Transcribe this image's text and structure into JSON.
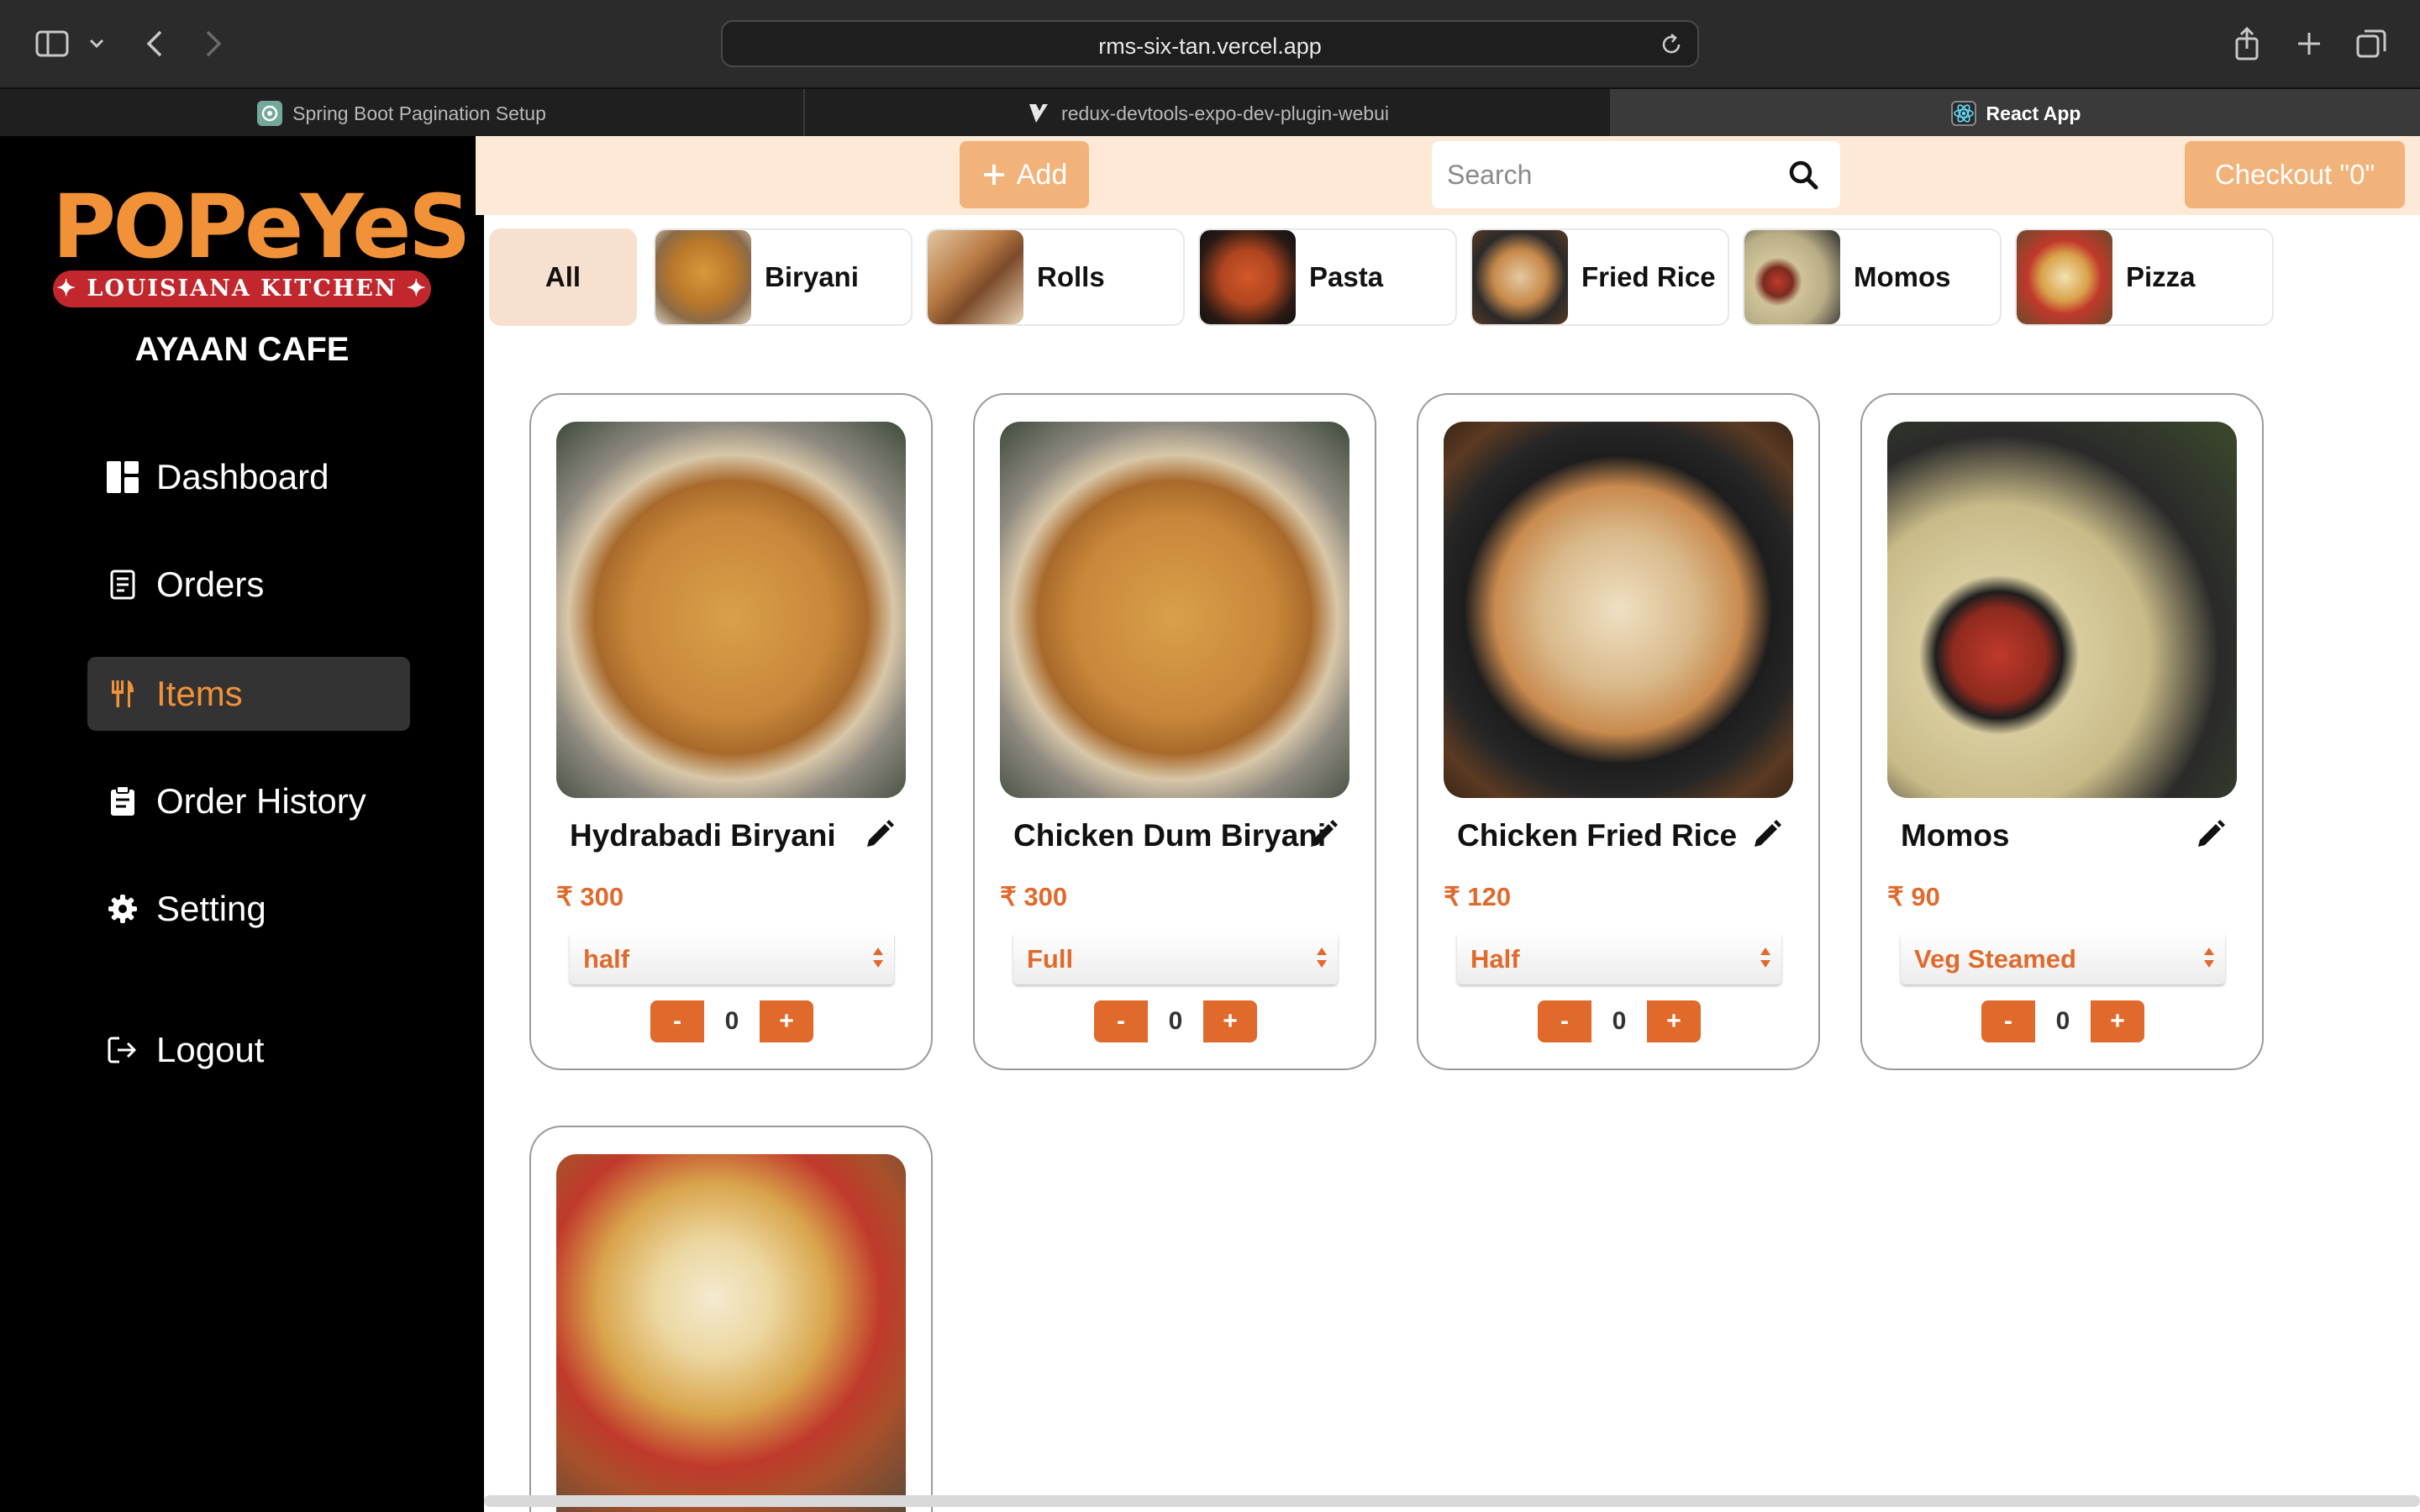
{
  "browser": {
    "url": "rms-six-tan.vercel.app",
    "tabs": [
      {
        "title": "Spring Boot Pagination Setup",
        "icon": "chatgpt-icon"
      },
      {
        "title": "redux-devtools-expo-dev-plugin-webui",
        "icon": "expo-icon"
      },
      {
        "title": "React App",
        "icon": "react-icon"
      }
    ]
  },
  "sidebar": {
    "logo_word": "POPeYeS",
    "logo_banner": "✦ LOUISIANA KITCHEN ✦",
    "cafe_name": "AYAAN CAFE",
    "items": [
      {
        "label": "Dashboard",
        "icon": "dashboard-icon"
      },
      {
        "label": "Orders",
        "icon": "receipt-icon"
      },
      {
        "label": "Items",
        "icon": "utensils-icon",
        "active": true
      },
      {
        "label": "Order History",
        "icon": "clipboard-icon"
      },
      {
        "label": "Setting",
        "icon": "gear-icon"
      },
      {
        "label": "Logout",
        "icon": "logout-icon"
      }
    ]
  },
  "header": {
    "add_label": "Add",
    "search_placeholder": "Search",
    "checkout_label": "Checkout \"0\""
  },
  "categories": [
    {
      "label": "All",
      "selected": true
    },
    {
      "label": "Biryani"
    },
    {
      "label": "Rolls"
    },
    {
      "label": "Pasta"
    },
    {
      "label": "Fried Rice"
    },
    {
      "label": "Momos"
    },
    {
      "label": "Pizza"
    }
  ],
  "items": [
    {
      "name": "Hydrabadi Biryani",
      "price": "₹ 300",
      "variant": "half",
      "qty": "0"
    },
    {
      "name": "Chicken Dum Biryani",
      "price": "₹ 300",
      "variant": "Full",
      "qty": "0"
    },
    {
      "name": "Chicken Fried Rice",
      "price": "₹ 120",
      "variant": "Half",
      "qty": "0"
    },
    {
      "name": "Momos",
      "price": "₹ 90",
      "variant": "Veg Steamed",
      "qty": "0"
    }
  ],
  "qty_controls": {
    "minus": "-",
    "plus": "+"
  },
  "colors": {
    "accent": "#f29238",
    "price": "#e06a2c",
    "header_bg": "#fde9d6",
    "button_bg": "#f2b37a",
    "sidebar_bg": "#000000"
  }
}
